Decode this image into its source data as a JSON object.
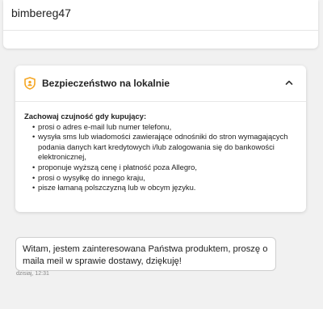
{
  "header": {
    "username": "bimbereg47"
  },
  "security": {
    "title": "Bezpieczeństwo na lokalnie",
    "lead": "Zachowaj czujność gdy kupujący:",
    "items": [
      "prosi o adres e-mail lub numer telefonu,",
      "wysyła sms lub wiadomości zawierające odnośniki do stron wymagających podania danych kart kredytowych i/lub zalogowania się do bankowości elektronicznej,",
      "proponuje wyższą cenę i płatność poza Allegro,",
      "prosi o wysyłkę do innego kraju,",
      "pisze łamaną polszczyzną lub w obcym języku."
    ],
    "icon": "shield-person-icon",
    "accent_color": "#f5a623",
    "toggle_icon": "chevron-up-icon"
  },
  "message": {
    "text": "Witam, jestem zainteresowana Państwa produktem, proszę o maila meil w sprawie dostawy, dziękuję!",
    "time": "dzisiaj, 12:31"
  }
}
